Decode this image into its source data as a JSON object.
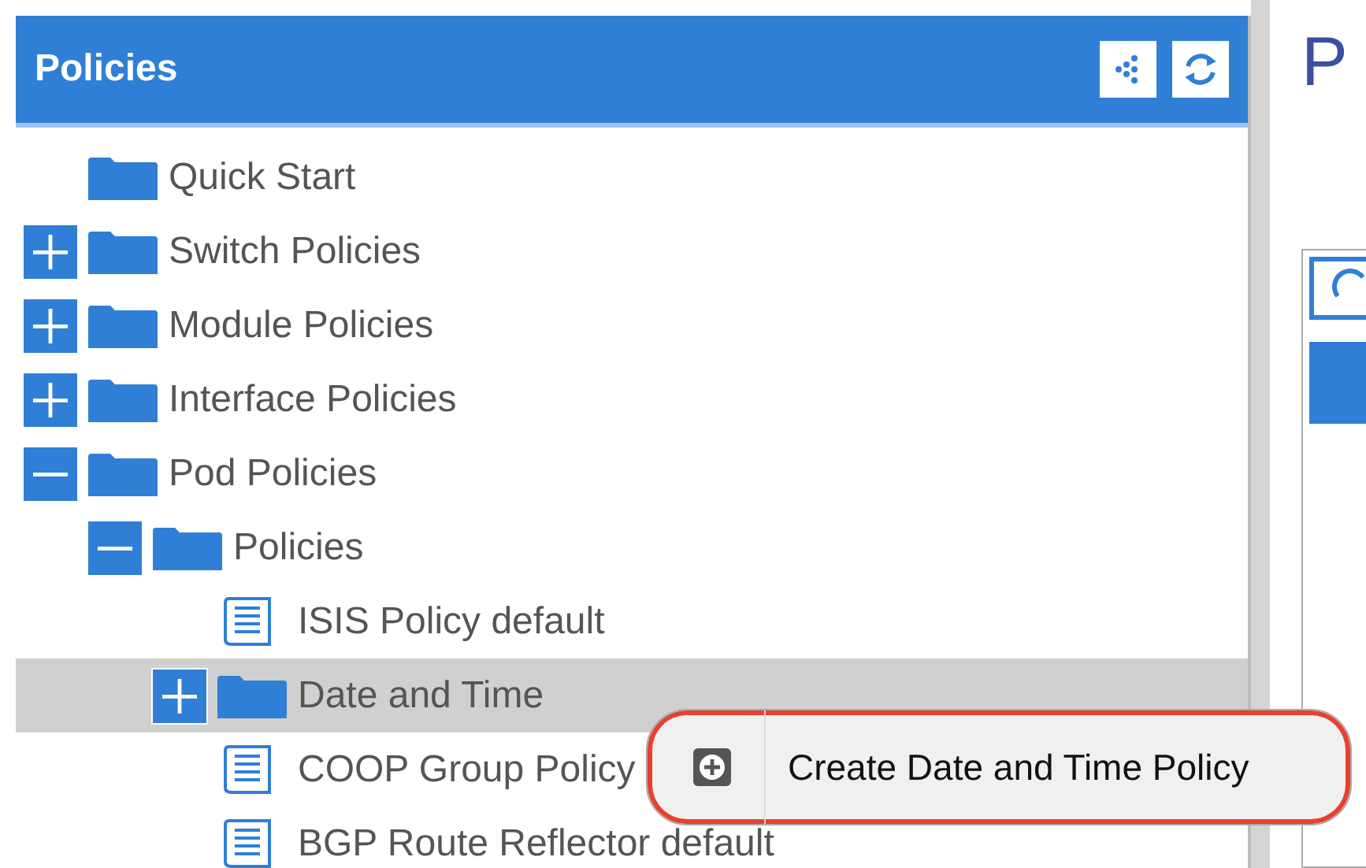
{
  "panel": {
    "title": "Policies"
  },
  "tree": [
    {
      "label": "Quick Start",
      "kind": "folder",
      "selected": false
    },
    {
      "label": "Switch Policies",
      "kind": "folder",
      "expanded": false,
      "selected": false
    },
    {
      "label": "Module Policies",
      "kind": "folder",
      "expanded": false,
      "selected": false
    },
    {
      "label": "Interface Policies",
      "kind": "folder",
      "expanded": false,
      "selected": false
    },
    {
      "label": "Pod Policies",
      "kind": "folder",
      "expanded": true,
      "selected": false,
      "children": [
        {
          "label": "Policies",
          "kind": "folder",
          "expanded": true,
          "selected": false,
          "children": [
            {
              "label": "ISIS Policy default",
              "kind": "document",
              "selected": false
            },
            {
              "label": "Date and Time",
              "kind": "folder",
              "expanded": false,
              "selected": true
            },
            {
              "label": "COOP Group Policy",
              "kind": "document",
              "selected": false
            },
            {
              "label": "BGP Route Reflector default",
              "kind": "document",
              "selected": false
            }
          ]
        }
      ]
    }
  ],
  "context_menu": {
    "items": [
      {
        "label": "Create Date and Time Policy",
        "highlighted": true
      }
    ]
  },
  "right_pane": {
    "title": "P"
  }
}
